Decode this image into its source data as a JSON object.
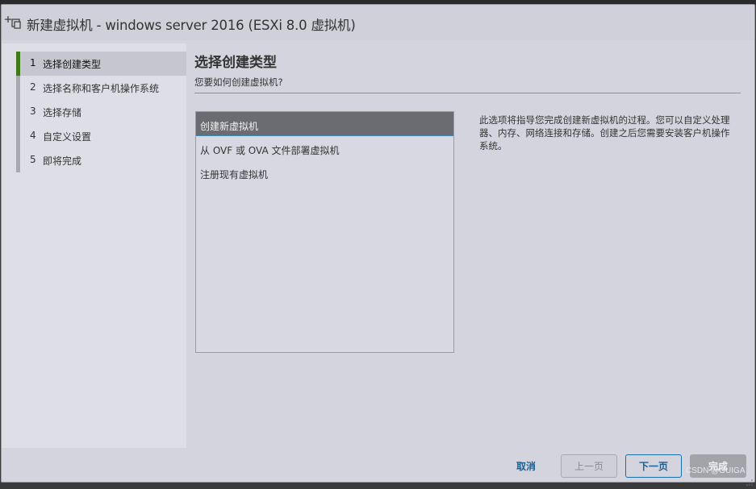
{
  "window": {
    "title": "新建虚拟机 - windows server 2016 (ESXi 8.0 虚拟机)",
    "icon": "new-vm-icon"
  },
  "sidebar": {
    "steps": [
      {
        "num": "1",
        "label": "选择创建类型",
        "active": true
      },
      {
        "num": "2",
        "label": "选择名称和客户机操作系统",
        "active": false
      },
      {
        "num": "3",
        "label": "选择存储",
        "active": false
      },
      {
        "num": "4",
        "label": "自定义设置",
        "active": false
      },
      {
        "num": "5",
        "label": "即将完成",
        "active": false
      }
    ]
  },
  "main": {
    "title": "选择创建类型",
    "subtitle": "您要如何创建虚拟机?",
    "options": [
      {
        "label": "创建新虚拟机",
        "selected": true
      },
      {
        "label": "从 OVF 或 OVA 文件部署虚拟机",
        "selected": false
      },
      {
        "label": "注册现有虚拟机",
        "selected": false
      }
    ],
    "description": "此选项将指导您完成创建新虚拟机的过程。您可以自定义处理器、内存、网络连接和存储。创建之后您需要安装客户机操作系统。"
  },
  "footer": {
    "cancel": "取消",
    "prev": "上一页",
    "next": "下一页",
    "finish": "完成"
  },
  "watermark": "CSDN @GUIGA",
  "colors": {
    "active_step_bar": "#3f7a1a",
    "primary_link": "#1a5f93",
    "selected_option_bg": "#6b6b72"
  }
}
